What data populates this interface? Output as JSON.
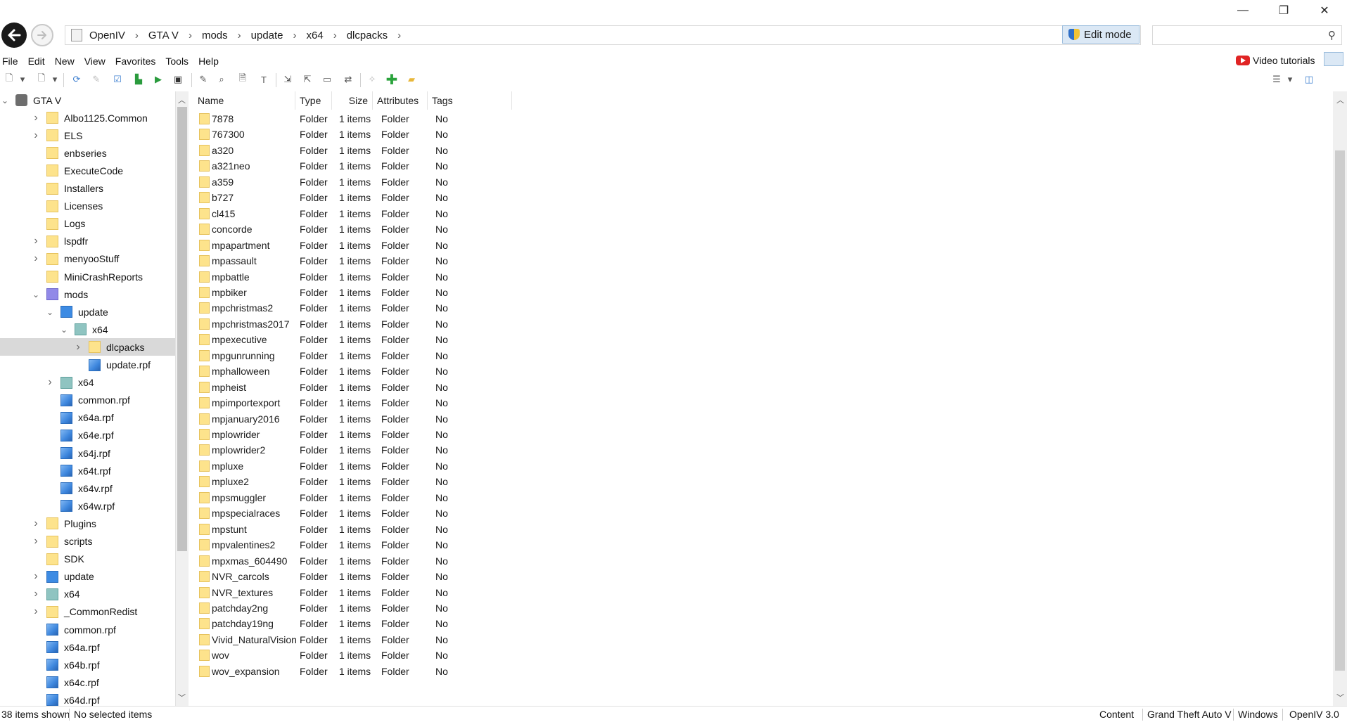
{
  "window": {
    "minimize": "—",
    "restore": "❐",
    "close": "✕"
  },
  "address": {
    "crumbs": [
      "OpenIV",
      "GTA V",
      "mods",
      "update",
      "x64",
      "dlcpacks"
    ],
    "separator": "›"
  },
  "edit_mode_label": "Edit mode",
  "search": {
    "placeholder": ""
  },
  "menu": [
    "File",
    "Edit",
    "New",
    "View",
    "Favorites",
    "Tools",
    "Help"
  ],
  "video_tutorials_label": "Video tutorials",
  "tree": [
    {
      "label": "GTA V",
      "icon": "gta-icon",
      "expanded": true
    },
    {
      "label": "Albo1125.Common",
      "icon": "folder-icon",
      "chevron": "right"
    },
    {
      "label": "ELS",
      "icon": "folder-icon",
      "chevron": "right"
    },
    {
      "label": "enbseries",
      "icon": "folder-icon"
    },
    {
      "label": "ExecuteCode",
      "icon": "folder-icon"
    },
    {
      "label": "Installers",
      "icon": "folder-icon"
    },
    {
      "label": "Licenses",
      "icon": "folder-icon"
    },
    {
      "label": "Logs",
      "icon": "folder-icon"
    },
    {
      "label": "lspdfr",
      "icon": "folder-icon",
      "chevron": "right"
    },
    {
      "label": "menyooStuff",
      "icon": "folder-icon",
      "chevron": "right"
    },
    {
      "label": "MiniCrashReports",
      "icon": "folder-icon"
    },
    {
      "label": "mods",
      "icon": "mods-folder-icon",
      "chevron": "down"
    },
    {
      "label": "update",
      "icon": "update-folder-icon",
      "chevron": "down"
    },
    {
      "label": "x64",
      "icon": "x64-folder-icon",
      "chevron": "down"
    },
    {
      "label": "dlcpacks",
      "icon": "folder-icon",
      "chevron": "right",
      "selected": true
    },
    {
      "label": "update.rpf",
      "icon": "rpf-icon"
    },
    {
      "label": "x64",
      "icon": "x64-folder-icon",
      "chevron": "right"
    },
    {
      "label": "common.rpf",
      "icon": "rpf-icon"
    },
    {
      "label": "x64a.rpf",
      "icon": "rpf-icon"
    },
    {
      "label": "x64e.rpf",
      "icon": "rpf-icon"
    },
    {
      "label": "x64j.rpf",
      "icon": "rpf-icon"
    },
    {
      "label": "x64t.rpf",
      "icon": "rpf-icon"
    },
    {
      "label": "x64v.rpf",
      "icon": "rpf-icon"
    },
    {
      "label": "x64w.rpf",
      "icon": "rpf-icon"
    },
    {
      "label": "Plugins",
      "icon": "folder-icon",
      "chevron": "right"
    },
    {
      "label": "scripts",
      "icon": "folder-icon",
      "chevron": "right"
    },
    {
      "label": "SDK",
      "icon": "folder-icon"
    },
    {
      "label": "update",
      "icon": "update-folder-icon",
      "chevron": "right"
    },
    {
      "label": "x64",
      "icon": "x64-folder-icon",
      "chevron": "right"
    },
    {
      "label": "_CommonRedist",
      "icon": "folder-icon",
      "chevron": "right"
    },
    {
      "label": "common.rpf",
      "icon": "rpf-icon"
    },
    {
      "label": "x64a.rpf",
      "icon": "rpf-icon"
    },
    {
      "label": "x64b.rpf",
      "icon": "rpf-icon"
    },
    {
      "label": "x64c.rpf",
      "icon": "rpf-icon"
    },
    {
      "label": "x64d.rpf",
      "icon": "rpf-icon"
    }
  ],
  "columns": [
    "Name",
    "Type",
    "Size",
    "Attributes",
    "Tags"
  ],
  "files": [
    [
      "7878",
      "Folder",
      "1 items",
      "Folder",
      "No"
    ],
    [
      "767300",
      "Folder",
      "1 items",
      "Folder",
      "No"
    ],
    [
      "a320",
      "Folder",
      "1 items",
      "Folder",
      "No"
    ],
    [
      "a321neo",
      "Folder",
      "1 items",
      "Folder",
      "No"
    ],
    [
      "a359",
      "Folder",
      "1 items",
      "Folder",
      "No"
    ],
    [
      "b727",
      "Folder",
      "1 items",
      "Folder",
      "No"
    ],
    [
      "cl415",
      "Folder",
      "1 items",
      "Folder",
      "No"
    ],
    [
      "concorde",
      "Folder",
      "1 items",
      "Folder",
      "No"
    ],
    [
      "mpapartment",
      "Folder",
      "1 items",
      "Folder",
      "No"
    ],
    [
      "mpassault",
      "Folder",
      "1 items",
      "Folder",
      "No"
    ],
    [
      "mpbattle",
      "Folder",
      "1 items",
      "Folder",
      "No"
    ],
    [
      "mpbiker",
      "Folder",
      "1 items",
      "Folder",
      "No"
    ],
    [
      "mpchristmas2",
      "Folder",
      "1 items",
      "Folder",
      "No"
    ],
    [
      "mpchristmas2017",
      "Folder",
      "1 items",
      "Folder",
      "No"
    ],
    [
      "mpexecutive",
      "Folder",
      "1 items",
      "Folder",
      "No"
    ],
    [
      "mpgunrunning",
      "Folder",
      "1 items",
      "Folder",
      "No"
    ],
    [
      "mphalloween",
      "Folder",
      "1 items",
      "Folder",
      "No"
    ],
    [
      "mpheist",
      "Folder",
      "1 items",
      "Folder",
      "No"
    ],
    [
      "mpimportexport",
      "Folder",
      "1 items",
      "Folder",
      "No"
    ],
    [
      "mpjanuary2016",
      "Folder",
      "1 items",
      "Folder",
      "No"
    ],
    [
      "mplowrider",
      "Folder",
      "1 items",
      "Folder",
      "No"
    ],
    [
      "mplowrider2",
      "Folder",
      "1 items",
      "Folder",
      "No"
    ],
    [
      "mpluxe",
      "Folder",
      "1 items",
      "Folder",
      "No"
    ],
    [
      "mpluxe2",
      "Folder",
      "1 items",
      "Folder",
      "No"
    ],
    [
      "mpsmuggler",
      "Folder",
      "1 items",
      "Folder",
      "No"
    ],
    [
      "mpspecialraces",
      "Folder",
      "1 items",
      "Folder",
      "No"
    ],
    [
      "mpstunt",
      "Folder",
      "1 items",
      "Folder",
      "No"
    ],
    [
      "mpvalentines2",
      "Folder",
      "1 items",
      "Folder",
      "No"
    ],
    [
      "mpxmas_604490",
      "Folder",
      "1 items",
      "Folder",
      "No"
    ],
    [
      "NVR_carcols",
      "Folder",
      "1 items",
      "Folder",
      "No"
    ],
    [
      "NVR_textures",
      "Folder",
      "1 items",
      "Folder",
      "No"
    ],
    [
      "patchday2ng",
      "Folder",
      "1 items",
      "Folder",
      "No"
    ],
    [
      "patchday19ng",
      "Folder",
      "1 items",
      "Folder",
      "No"
    ],
    [
      "Vivid_NaturalVision",
      "Folder",
      "1 items",
      "Folder",
      "No"
    ],
    [
      "wov",
      "Folder",
      "1 items",
      "Folder",
      "No"
    ],
    [
      "wov_expansion",
      "Folder",
      "1 items",
      "Folder",
      "No"
    ]
  ],
  "status": {
    "items_shown": "38 items shown",
    "selection": "No selected items",
    "right": [
      "Content",
      "Grand Theft Auto V",
      "Windows",
      "OpenIV 3.0"
    ]
  }
}
